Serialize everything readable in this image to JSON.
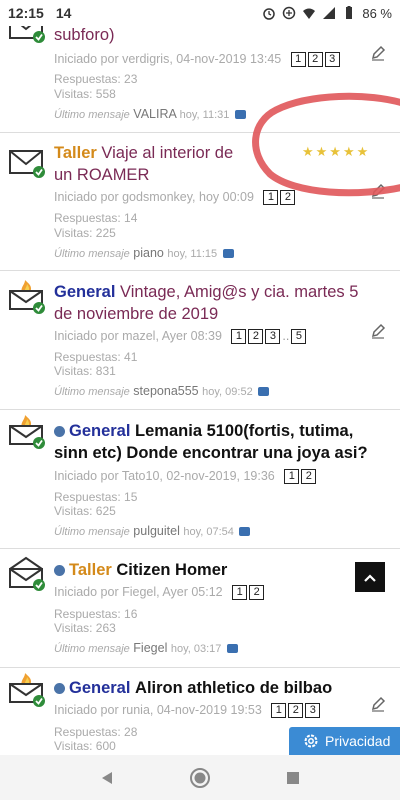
{
  "status": {
    "time": "12:15",
    "notif": "14",
    "battery": "86 %"
  },
  "topics": [
    {
      "title": "subforo)",
      "author_line": "Iniciado por verdigris, 04-nov-2019 13:45",
      "pages": [
        "1",
        "2",
        "3"
      ],
      "replies": "Respuestas: 23",
      "views": "Visitas: 558",
      "last_label": "Último mensaje",
      "last_user": "VALIRA",
      "last_time": "hoy, 11:31"
    },
    {
      "category": "Taller",
      "title": "Viaje al interior de un ROAMER",
      "author_line": "Iniciado por godsmonkey, hoy 00:09",
      "pages": [
        "1",
        "2"
      ],
      "replies": "Respuestas: 14",
      "views": "Visitas: 225",
      "last_label": "Último mensaje",
      "last_user": "piano",
      "last_time": "hoy, 11:15",
      "rating": "★★★★★"
    },
    {
      "category": "General",
      "title": "Vintage, Amig@s y cia. martes 5 de noviembre de 2019",
      "author_line": "Iniciado por mazel, Ayer 08:39",
      "pages": [
        "1",
        "2",
        "3",
        "5"
      ],
      "replies": "Respuestas: 41",
      "views": "Visitas: 831",
      "last_label": "Último mensaje",
      "last_user": "stepona555",
      "last_time": "hoy, 09:52"
    },
    {
      "category": "General",
      "title": "Lemania 5100(fortis, tutima, sinn etc) Donde encontrar una joya asi?",
      "author_line": "Iniciado por Tato10, 02-nov-2019, 19:36",
      "pages": [
        "1",
        "2"
      ],
      "replies": "Respuestas: 15",
      "views": "Visitas: 625",
      "last_label": "Último mensaje",
      "last_user": "pulguitel",
      "last_time": "hoy, 07:54"
    },
    {
      "category": "Taller",
      "title": "Citizen Homer",
      "author_line": "Iniciado por Fiegel, Ayer 05:12",
      "pages": [
        "1",
        "2"
      ],
      "replies": "Respuestas: 16",
      "views": "Visitas: 263",
      "last_label": "Último mensaje",
      "last_user": "Fiegel",
      "last_time": "hoy, 03:17"
    },
    {
      "category": "General",
      "title": "Aliron athletico de bilbao",
      "author_line": "Iniciado por runia, 04-nov-2019 19:53",
      "pages": [
        "1",
        "2",
        "3"
      ],
      "replies": "Respuestas: 28",
      "views": "Visitas: 600"
    }
  ],
  "privacy_label": "Privacidad",
  "colors": {
    "taller": "#d48a1a",
    "general": "#23309a",
    "accent": "#3b8bd4",
    "annotation": "#e0575a"
  }
}
